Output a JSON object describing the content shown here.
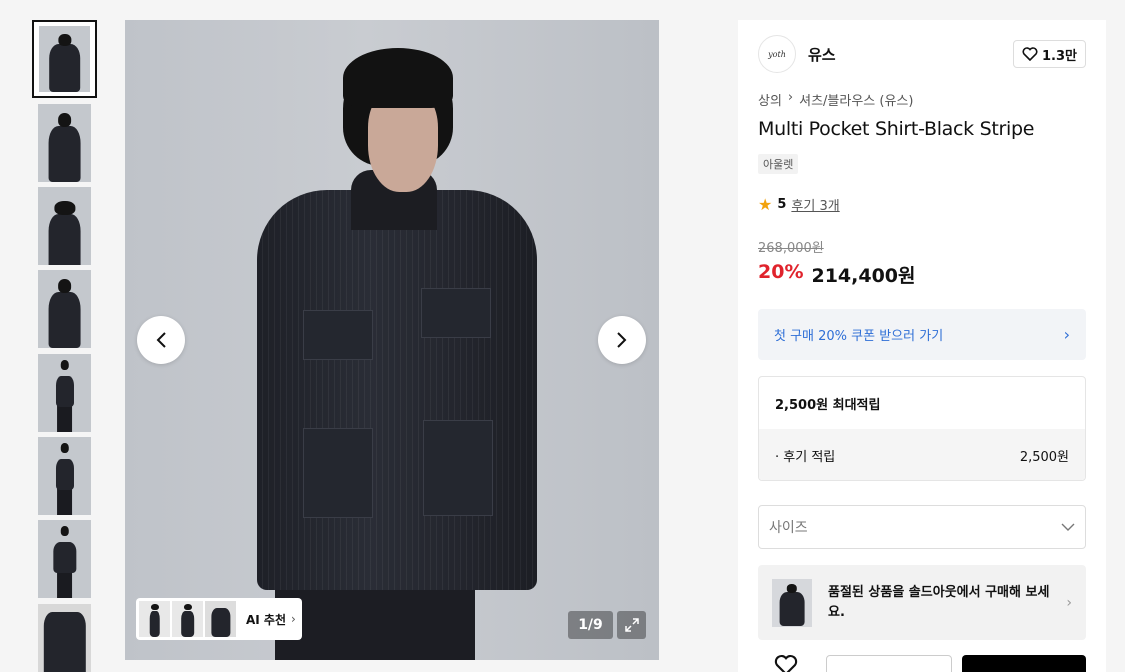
{
  "gallery": {
    "thumbnail_count": 8,
    "counter": "1/9",
    "ai_recommend_label": "AI 추천"
  },
  "brand": {
    "logo_text": "yoth",
    "name": "유스",
    "likes": "1.3만"
  },
  "breadcrumb": {
    "category": "상의",
    "separator": "›",
    "subcategory": "셔츠/블라우스 (유스)"
  },
  "product": {
    "title": "Multi Pocket Shirt-Black Stripe",
    "tag": "아울렛",
    "rating_score": "5",
    "review_link": "후기 3개",
    "original_price": "268,000원",
    "discount": "20%",
    "price": "214,400원"
  },
  "coupon": {
    "label": "첫 구매 20% 쿠폰 받으러 가기"
  },
  "points": {
    "header": "2,500원 최대적립",
    "row_label": "· 후기 적립",
    "row_amount": "2,500원"
  },
  "size_select": {
    "placeholder": "사이즈"
  },
  "soldout_banner": {
    "text": "품절된 상품을 솔드아웃에서 구매해 보세요."
  },
  "colors": {
    "discount": "#e0232c",
    "coupon_text": "#2f6fd6",
    "star": "#f2a20c"
  }
}
